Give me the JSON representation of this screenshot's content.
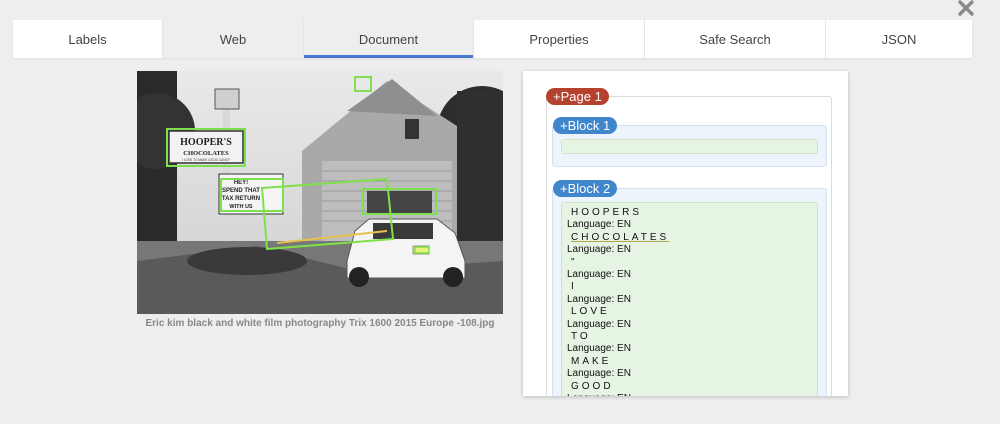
{
  "tabs": [
    {
      "label": "Labels",
      "w": 150
    },
    {
      "label": "Web",
      "w": 141
    },
    {
      "label": "Document",
      "w": 170
    },
    {
      "label": "Properties",
      "w": 171
    },
    {
      "label": "Safe Search",
      "w": 181
    },
    {
      "label": "JSON",
      "w": 146
    }
  ],
  "photo": {
    "caption": "Eric kim black and white film photography Trix 1600 2015 Europe -108.jpg",
    "sign_hoopers": "HOOPER'S",
    "sign_chocolates": "CHOCOLATES",
    "sign_tagline": "I LOVE TO MAKE GOOD CANDY",
    "sign_hey": "HEY!",
    "sign_spend": "SPEND THAT",
    "sign_tax": "TAX RETURN",
    "sign_with": "WITH US"
  },
  "result": {
    "page_label": "+Page 1",
    "block1_label": "+Block 1",
    "block2_label": "+Block 2",
    "language_label": "Language: EN",
    "words": [
      "HOOPERS",
      "CHOCOLATES",
      "\"",
      "I",
      "LOVE",
      "TO",
      "MAKE",
      "GOOD"
    ]
  },
  "colors": {
    "page_pill": "#b5412f",
    "block_pill": "#3f86cc",
    "tab_active_underline": "#4a7ad0",
    "highlight_green": "#7ee04a",
    "highlight_yellow": "#e6c24a"
  },
  "icons": {
    "close": "close-icon"
  }
}
